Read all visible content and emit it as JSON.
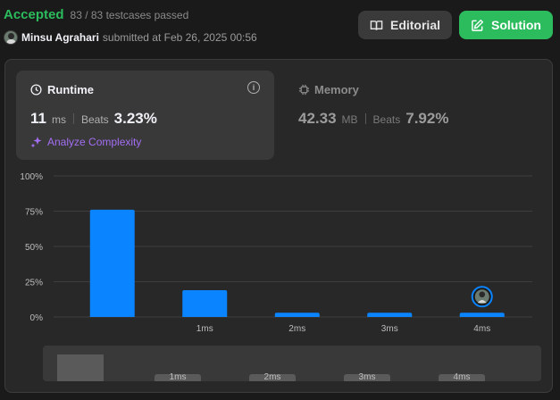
{
  "header": {
    "status": "Accepted",
    "testcases": "83 / 83 testcases passed",
    "username": "Minsu Agrahari",
    "submitted_text": "submitted at Feb 26, 2025 00:56",
    "editorial_label": "Editorial",
    "solution_label": "Solution",
    "status_color": "#2cbb5d"
  },
  "runtime": {
    "title": "Runtime",
    "value": "11",
    "unit": "ms",
    "beats_label": "Beats",
    "beats_value": "3.23%",
    "analyze_label": "Analyze Complexity"
  },
  "memory": {
    "title": "Memory",
    "value": "42.33",
    "unit": "MB",
    "beats_label": "Beats",
    "beats_value": "7.92%"
  },
  "chart_data": {
    "type": "bar",
    "categories": [
      "",
      "1ms",
      "2ms",
      "3ms",
      "4ms"
    ],
    "values": [
      76,
      19,
      3,
      3,
      3
    ],
    "y_ticks": [
      "100%",
      "75%",
      "50%",
      "25%",
      "0%"
    ],
    "ylim": [
      0,
      100
    ],
    "grid": true,
    "bar_color": "#0a84ff",
    "marker_category": "4ms",
    "mini_chart": {
      "categories": [
        "",
        "1ms",
        "2ms",
        "3ms",
        "4ms"
      ],
      "bar_color": "#5a5a5a"
    }
  }
}
